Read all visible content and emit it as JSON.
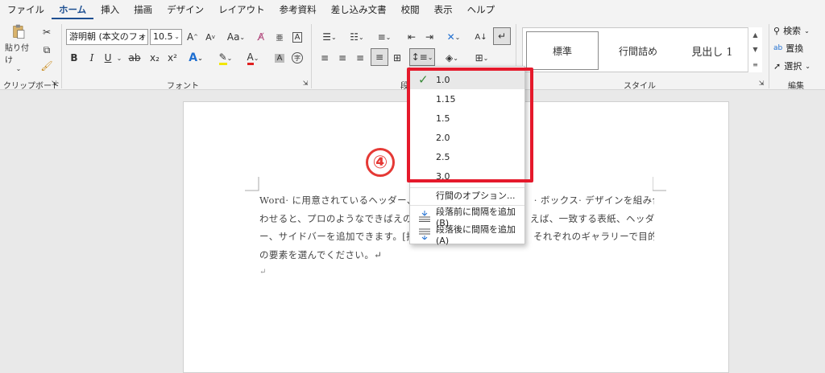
{
  "menubar": {
    "items": [
      "ファイル",
      "ホーム",
      "挿入",
      "描画",
      "デザイン",
      "レイアウト",
      "参考資料",
      "差し込み文書",
      "校閲",
      "表示",
      "ヘルプ"
    ]
  },
  "ribbon": {
    "clipboard": {
      "paste_label": "貼り付け",
      "group_label": "クリップボード"
    },
    "font": {
      "font_name": "游明朝 (本文のフォン",
      "font_size": "10.5",
      "case_label": "Aa",
      "bold": "B",
      "italic": "I",
      "underline": "U",
      "strike": "ab",
      "subscript": "x₂",
      "superscript": "x²",
      "group_label": "フォント"
    },
    "paragraph": {
      "group_label": "段"
    },
    "styles": {
      "items": [
        "標準",
        "行間詰め",
        "見出し 1"
      ],
      "group_label": "スタイル"
    },
    "editing": {
      "find": "検索",
      "replace": "置換",
      "select": "選択",
      "group_label": "編集"
    }
  },
  "line_spacing_menu": {
    "options": [
      "1.0",
      "1.15",
      "1.5",
      "2.0",
      "2.5",
      "3.0"
    ],
    "selected": "1.0",
    "line_options": "行間のオプション...",
    "add_before": "段落前に間隔を追加(B)",
    "add_after": "段落後に間隔を追加(A)"
  },
  "annotation": {
    "step": "④",
    "color": "#e5192b"
  },
  "document": {
    "lines": [
      "Word· に用意されているヘッダー、",
      "わせると、プロのようなできばえの",
      "ー、サイドバーを追加できます。[挿",
      "の要素を選んでください。↵"
    ],
    "lines_right": [
      "· ボックス· デザインを組み合",
      "えば、一致する表紙、ヘッダ",
      "それぞれのギャラリーで目的",
      ""
    ],
    "empty_para": "↵"
  }
}
